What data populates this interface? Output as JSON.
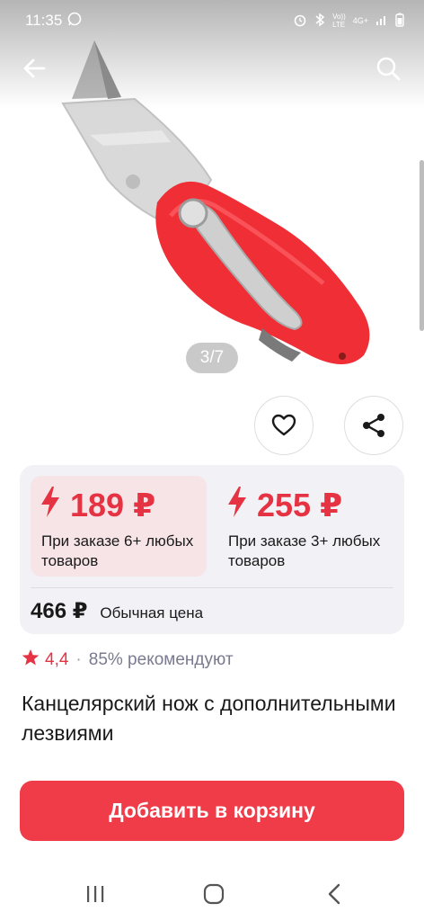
{
  "status_bar": {
    "time": "11:35",
    "network_lte": "Vo))\nLTE",
    "network_4g": "4G+"
  },
  "gallery": {
    "counter": "3/7"
  },
  "prices": {
    "tiers": [
      {
        "price": "189 ₽",
        "condition": "При заказе 6+ любых товаров"
      },
      {
        "price": "255 ₽",
        "condition": "При заказе 3+ любых товаров"
      }
    ],
    "regular_price": "466 ₽",
    "regular_label": "Обычная цена"
  },
  "rating": {
    "value": "4,4",
    "separator": "·",
    "recommend": "85% рекомендуют"
  },
  "product": {
    "title": "Канцелярский нож с дополнительными лезвиями"
  },
  "cart_button": {
    "label": "Добавить в корзину"
  },
  "colors": {
    "accent": "#f03c48",
    "price_red": "#e53343",
    "card_bg": "#f1f1f6",
    "active_tier_bg": "#f6e4e7"
  },
  "icons": [
    "back-arrow-icon",
    "search-icon",
    "heart-icon",
    "share-icon",
    "bolt-icon",
    "star-icon",
    "recent-apps-icon",
    "home-icon",
    "nav-back-icon"
  ]
}
